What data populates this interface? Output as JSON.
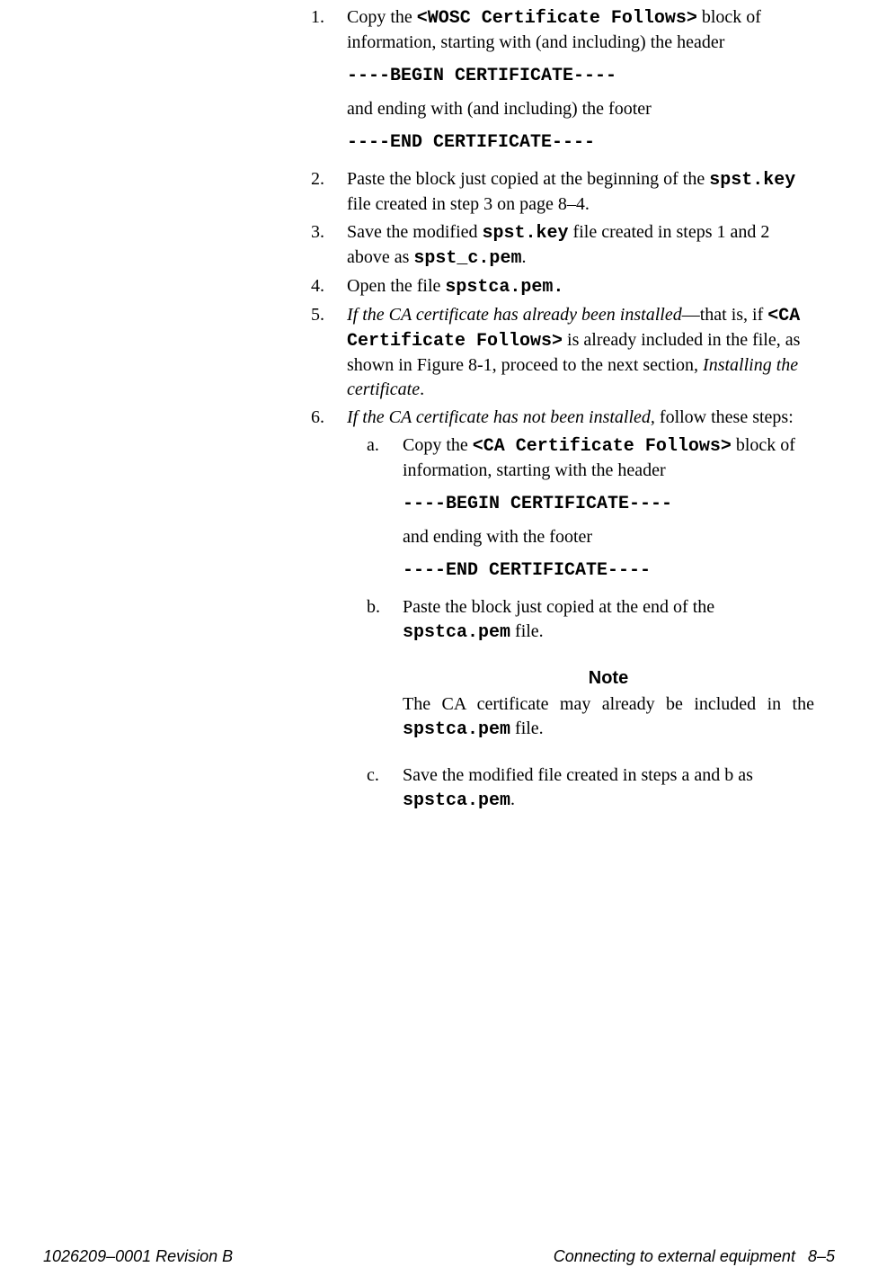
{
  "steps": {
    "s1": {
      "num": "1.",
      "text_a": "Copy the ",
      "code_a": "<WOSC Certificate Follows>",
      "text_b": " block of information, starting with (and including) the header",
      "block1": "----BEGIN CERTIFICATE----",
      "mid": "and ending with (and including) the footer",
      "block2": "----END CERTIFICATE----"
    },
    "s2": {
      "num": "2.",
      "text_a": "Paste the block just copied at the beginning of the ",
      "code_a": "spst.key",
      "text_b": " file created in step 3 on page 8–4."
    },
    "s3": {
      "num": "3.",
      "text_a": "Save the modified ",
      "code_a": "spst.key",
      "text_b": " file created in steps 1 and 2 above as ",
      "code_b": "spst_c.pem",
      "text_c": "."
    },
    "s4": {
      "num": "4.",
      "text_a": "Open the file ",
      "code_a": "spstca.pem."
    },
    "s5": {
      "num": "5.",
      "italic_a": "If the CA certificate has already been installed",
      "text_a": "—that is, if ",
      "code_a": "<CA Certificate Follows>",
      "text_b": " is already included in the file, as shown in Figure 8-1, proceed to the next section, ",
      "italic_b": "Installing the certificate",
      "text_c": "."
    },
    "s6": {
      "num": "6.",
      "italic_a": "If the CA certificate has not been installed,",
      "text_a": " follow these steps:",
      "a": {
        "letter": "a.",
        "text_a": "Copy the ",
        "code_a": "<CA Certificate Follows>",
        "text_b": " block of information, starting with the header",
        "block1": "----BEGIN CERTIFICATE----",
        "mid": "and ending with the footer",
        "block2": "----END CERTIFICATE----"
      },
      "b": {
        "letter": "b.",
        "text_a": "Paste the block just copied at the end of the ",
        "code_a": "spstca.pem",
        "text_b": " file."
      },
      "note": {
        "heading": "Note",
        "text_a": "The CA certificate may already be included in the ",
        "code_a": "spstca.pem",
        "text_b": " file."
      },
      "c": {
        "letter": "c.",
        "text_a": "Save the modified file created in steps a and b as ",
        "code_a": "spstca.pem",
        "text_b": "."
      }
    }
  },
  "footer": {
    "left": "1026209–0001  Revision B",
    "right_title": "Connecting to external equipment",
    "right_page": "8–5"
  }
}
